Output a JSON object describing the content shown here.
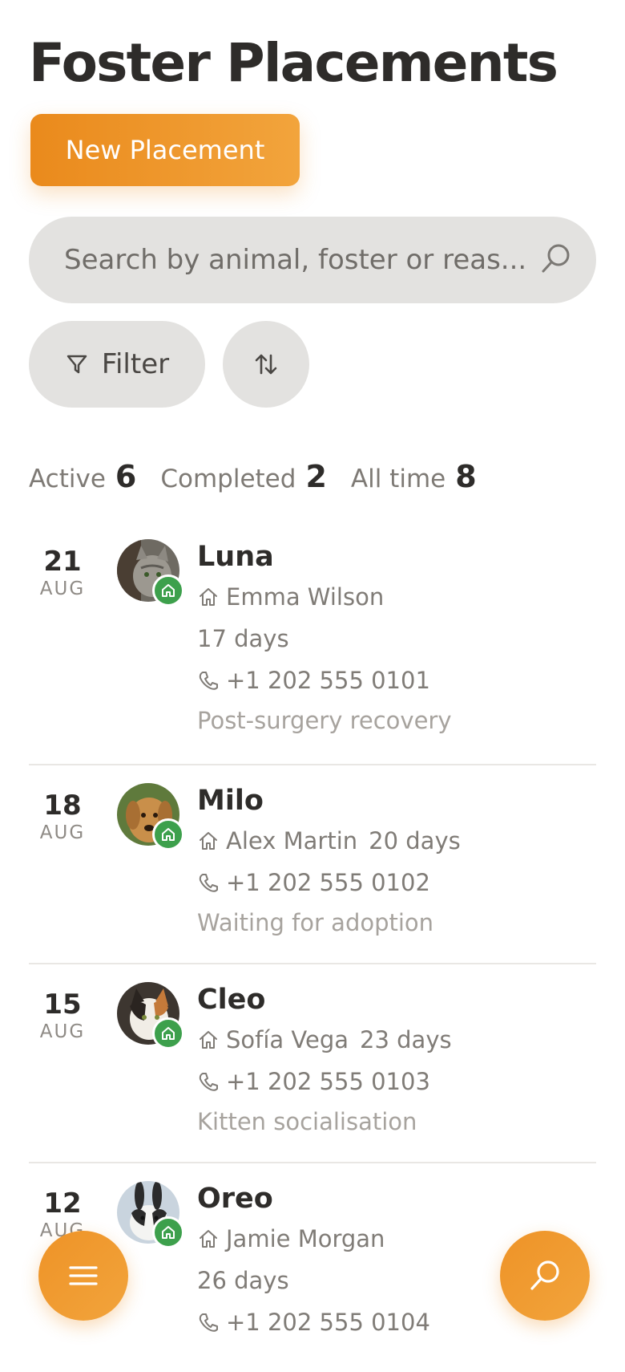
{
  "title": "Foster Placements",
  "new_button": "New Placement",
  "search": {
    "placeholder": "Search by animal, foster or reas..."
  },
  "filter_label": "Filter",
  "stats": [
    {
      "label": "Active",
      "value": "6"
    },
    {
      "label": "Completed",
      "value": "2"
    },
    {
      "label": "All time",
      "value": "8"
    }
  ],
  "placements": [
    {
      "day": "21",
      "month": "AUG",
      "name": "Luna",
      "foster": "Emma Wilson",
      "duration": "17 days",
      "phone": "+1 202 555 0101",
      "reason": "Post-surgery recovery",
      "avatar_icon": "gray-tabby-cat"
    },
    {
      "day": "18",
      "month": "AUG",
      "name": "Milo",
      "foster": "Alex Martin",
      "duration": "20 days",
      "phone": "+1 202 555 0102",
      "reason": "Waiting for adoption",
      "avatar_icon": "golden-retriever-dog"
    },
    {
      "day": "15",
      "month": "AUG",
      "name": "Cleo",
      "foster": "Sofía Vega",
      "duration": "23 days",
      "phone": "+1 202 555 0103",
      "reason": "Kitten socialisation",
      "avatar_icon": "calico-cat"
    },
    {
      "day": "12",
      "month": "AUG",
      "name": "Oreo",
      "foster": "Jamie Morgan",
      "duration": "26 days",
      "phone": "+1 202 555 0104",
      "reason": "",
      "avatar_icon": "black-white-rabbit"
    }
  ],
  "colors": {
    "accent": "#ee9327",
    "status_green": "#3da04c",
    "pill_bg": "#e3e2e0"
  }
}
